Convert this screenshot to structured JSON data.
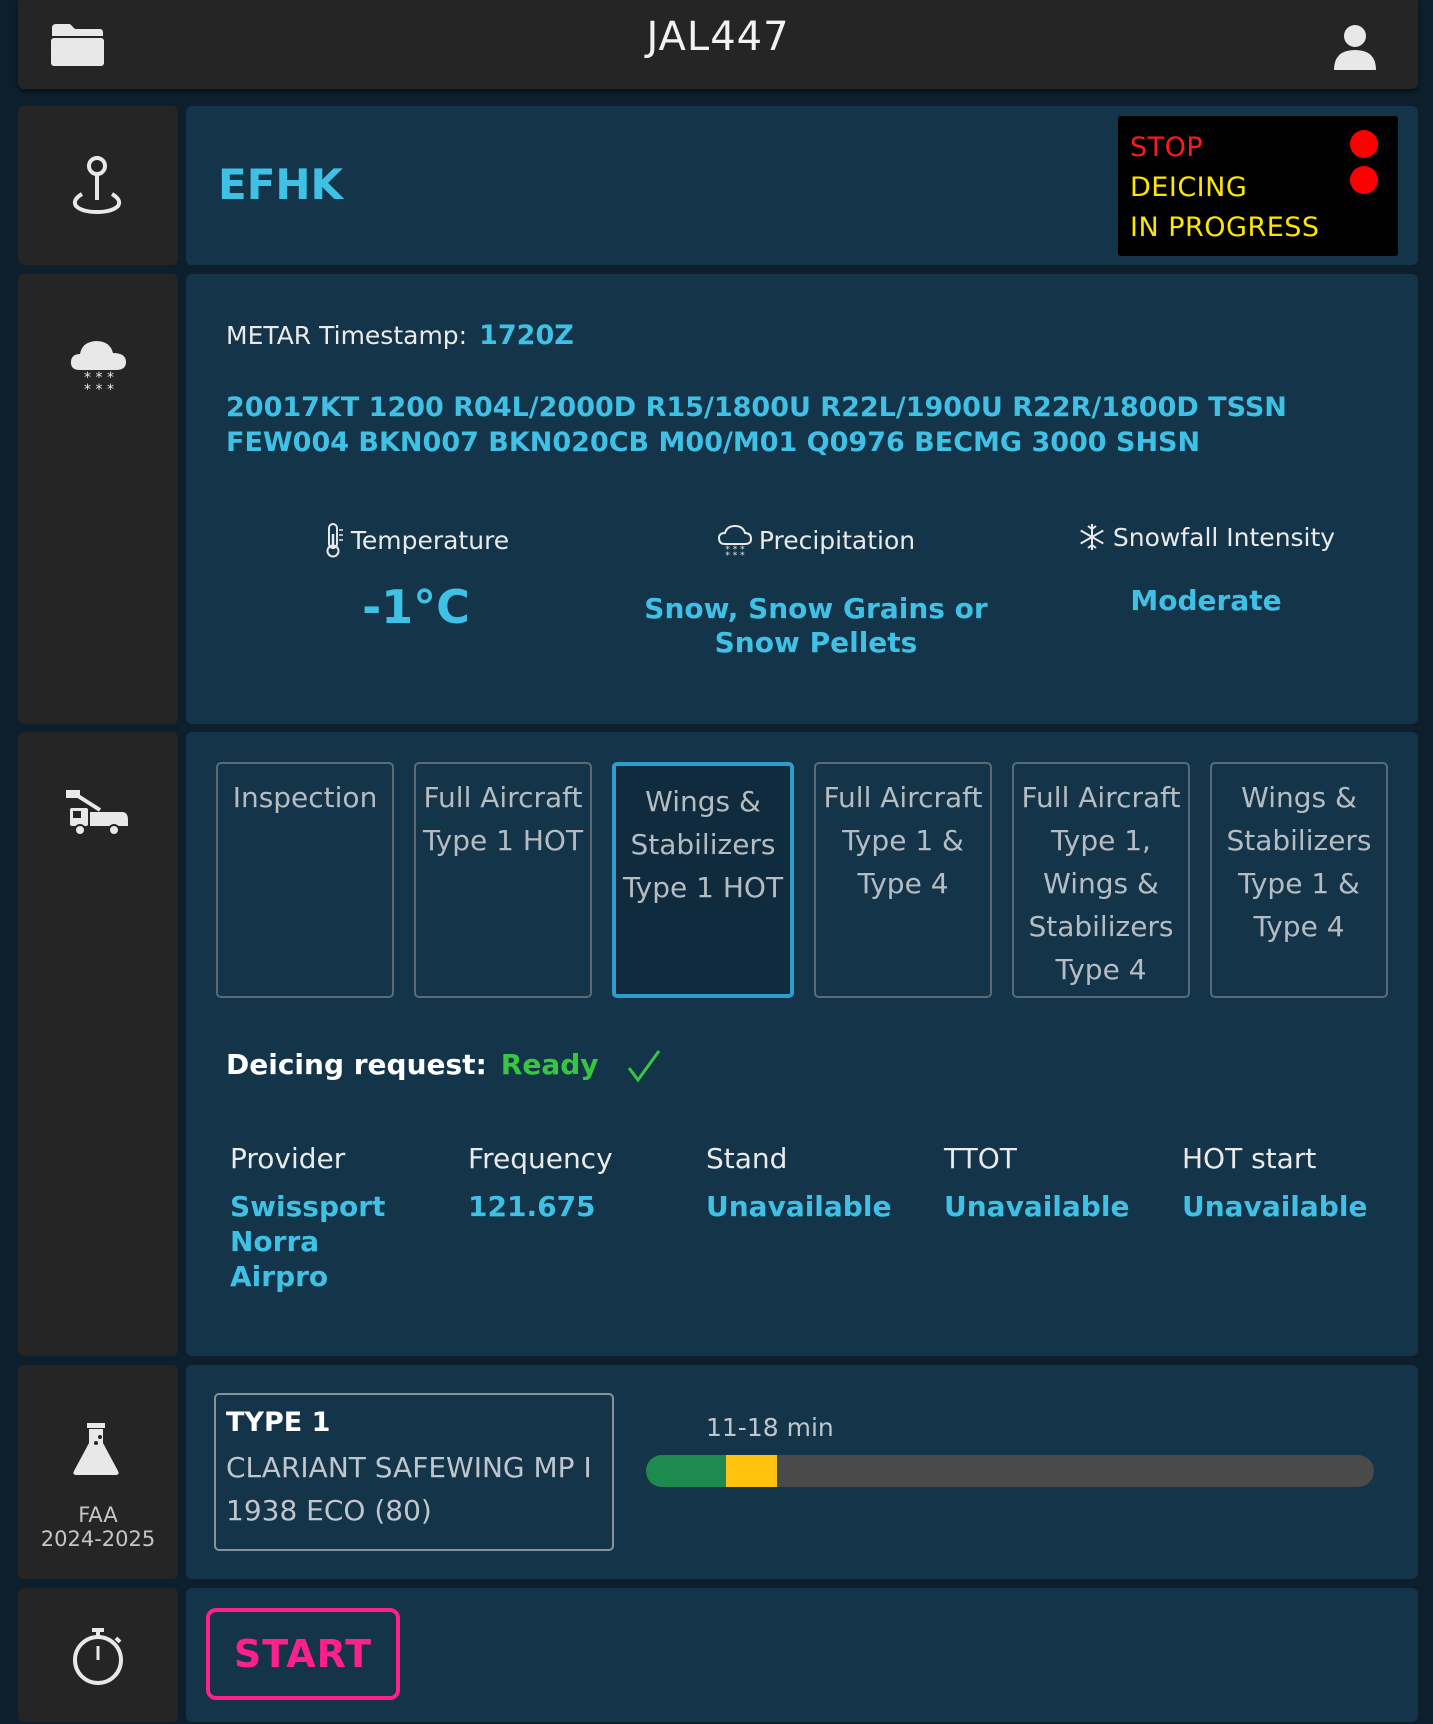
{
  "header": {
    "title": "JAL447",
    "left_icon": "folder-icon",
    "right_icon": "user-icon"
  },
  "location": {
    "airport": "EFHK",
    "alert": {
      "line1": "STOP",
      "line2": "DEICING",
      "line3": "IN PROGRESS",
      "line1_color": "#ff1a1a",
      "line2_3_color": "#ffe600",
      "indicator_color": "#ff0000"
    }
  },
  "weather": {
    "metar_label": "METAR Timestamp:",
    "metar_time": "1720Z",
    "metar_text": "20017KT 1200 R04L/2000D R15/1800U R22L/1900U R22R/1800D TSSN FEW004 BKN007 BKN020CB M00/M01 Q0976 BECMG 3000 SHSN",
    "temperature": {
      "label": "Temperature",
      "value": "-1°C"
    },
    "precipitation": {
      "label": "Precipitation",
      "value_line1": "Snow, Snow Grains or",
      "value_line2": "Snow Pellets"
    },
    "snowfall": {
      "label": "Snowfall Intensity",
      "value": "Moderate"
    }
  },
  "deicing": {
    "options": [
      {
        "lines": [
          "Inspection"
        ],
        "selected": false
      },
      {
        "lines": [
          "Full Aircraft",
          "Type 1 HOT"
        ],
        "selected": false
      },
      {
        "lines": [
          "Wings &",
          "Stabilizers",
          "Type 1 HOT"
        ],
        "selected": true
      },
      {
        "lines": [
          "Full Aircraft",
          "Type 1 &",
          "Type 4"
        ],
        "selected": false
      },
      {
        "lines": [
          "Full Aircraft",
          "Type 1,",
          "Wings &",
          "Stabilizers",
          "Type 4"
        ],
        "selected": false
      },
      {
        "lines": [
          "Wings &",
          "Stabilizers",
          "Type 1 &",
          "Type 4"
        ],
        "selected": false
      }
    ],
    "request_label": "Deicing request:",
    "request_status": "Ready",
    "info": {
      "provider": {
        "label": "Provider",
        "value": [
          "Swissport",
          "Norra",
          "Airpro"
        ]
      },
      "frequency": {
        "label": "Frequency",
        "value": "121.675"
      },
      "stand": {
        "label": "Stand",
        "value": "Unavailable"
      },
      "ttot": {
        "label": "TTOT",
        "value": "Unavailable"
      },
      "hot_start": {
        "label": "HOT start",
        "value": "Unavailable"
      }
    }
  },
  "hot": {
    "fluid_type": "TYPE 1",
    "fluid_name_line1": "CLARIANT SAFEWING MP I",
    "fluid_name_line2": "1938 ECO (80)",
    "range_label": "11-18 min",
    "green_fraction": 0.11,
    "yellow_fraction": 0.07,
    "colors": {
      "green": "#1f8a4d",
      "yellow": "#ffc20e",
      "track": "#4a4a4a"
    },
    "guideline_line1": "FAA",
    "guideline_line2": "2024-2025"
  },
  "timer": {
    "start_label": "START",
    "accent": "#ff1f8e"
  }
}
